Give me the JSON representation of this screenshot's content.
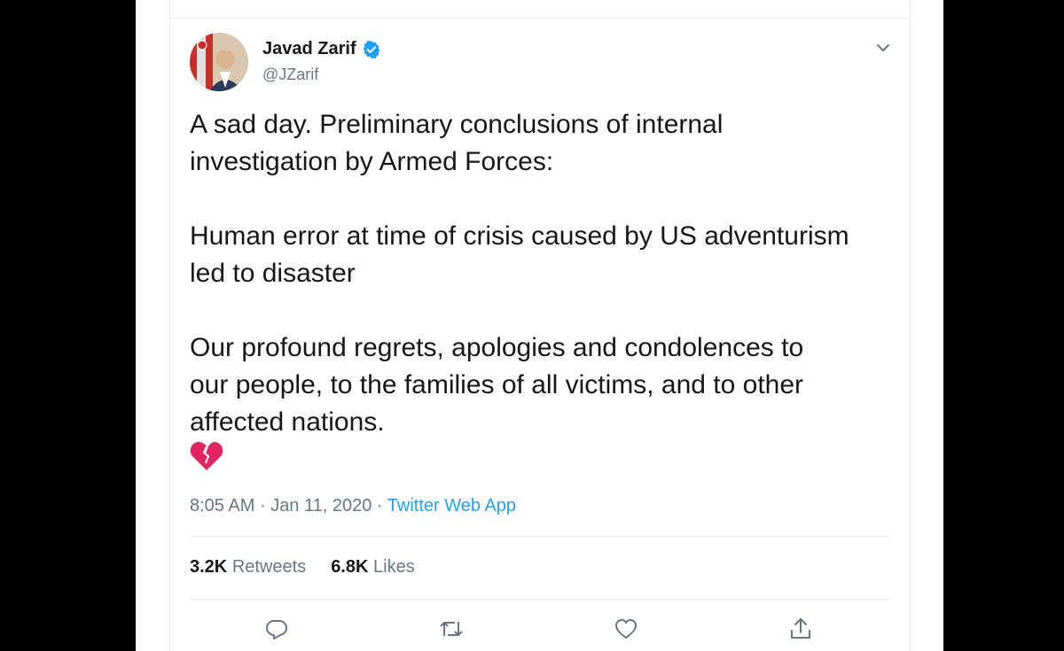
{
  "tweet": {
    "author_name": "Javad Zarif",
    "author_handle": "@JZarif",
    "paragraphs": [
      [
        "A sad day. Preliminary conclusions of internal",
        "investigation by Armed Forces:"
      ],
      [
        "Human error at time of crisis caused by US adventurism",
        "led to disaster"
      ],
      [
        "Our profound regrets, apologies and condolences to",
        "our people, to the families of all victims, and to other",
        "affected nations."
      ]
    ],
    "emoji": "broken-heart-emoji",
    "time": "8:05 AM",
    "date": "Jan 11, 2020",
    "sep": "·",
    "source": "Twitter Web App",
    "retweets_count": "3.2K",
    "retweets_label": "Retweets",
    "likes_count": "6.8K",
    "likes_label": "Likes"
  },
  "icons": {
    "verified": "verified-badge-icon",
    "menu": "chevron-down-icon",
    "reply": "reply-icon",
    "retweet": "retweet-icon",
    "like": "heart-icon",
    "share": "share-icon"
  },
  "colors": {
    "accent": "#1da1f2",
    "text": "#14171a",
    "secondary": "#657786",
    "broken_heart": "#e0245e"
  }
}
